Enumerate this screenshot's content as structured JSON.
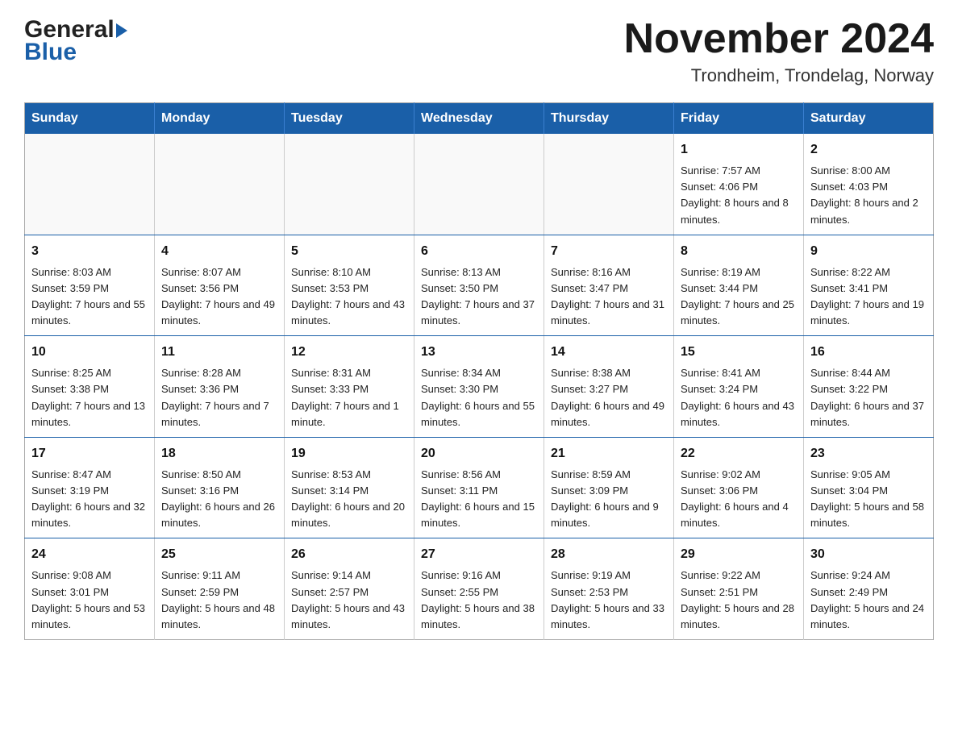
{
  "header": {
    "logo_general": "General",
    "logo_blue": "Blue",
    "month_title": "November 2024",
    "location": "Trondheim, Trondelag, Norway"
  },
  "calendar": {
    "days_of_week": [
      "Sunday",
      "Monday",
      "Tuesday",
      "Wednesday",
      "Thursday",
      "Friday",
      "Saturday"
    ],
    "weeks": [
      [
        {
          "day": "",
          "info": ""
        },
        {
          "day": "",
          "info": ""
        },
        {
          "day": "",
          "info": ""
        },
        {
          "day": "",
          "info": ""
        },
        {
          "day": "",
          "info": ""
        },
        {
          "day": "1",
          "info": "Sunrise: 7:57 AM\nSunset: 4:06 PM\nDaylight: 8 hours and 8 minutes."
        },
        {
          "day": "2",
          "info": "Sunrise: 8:00 AM\nSunset: 4:03 PM\nDaylight: 8 hours and 2 minutes."
        }
      ],
      [
        {
          "day": "3",
          "info": "Sunrise: 8:03 AM\nSunset: 3:59 PM\nDaylight: 7 hours and 55 minutes."
        },
        {
          "day": "4",
          "info": "Sunrise: 8:07 AM\nSunset: 3:56 PM\nDaylight: 7 hours and 49 minutes."
        },
        {
          "day": "5",
          "info": "Sunrise: 8:10 AM\nSunset: 3:53 PM\nDaylight: 7 hours and 43 minutes."
        },
        {
          "day": "6",
          "info": "Sunrise: 8:13 AM\nSunset: 3:50 PM\nDaylight: 7 hours and 37 minutes."
        },
        {
          "day": "7",
          "info": "Sunrise: 8:16 AM\nSunset: 3:47 PM\nDaylight: 7 hours and 31 minutes."
        },
        {
          "day": "8",
          "info": "Sunrise: 8:19 AM\nSunset: 3:44 PM\nDaylight: 7 hours and 25 minutes."
        },
        {
          "day": "9",
          "info": "Sunrise: 8:22 AM\nSunset: 3:41 PM\nDaylight: 7 hours and 19 minutes."
        }
      ],
      [
        {
          "day": "10",
          "info": "Sunrise: 8:25 AM\nSunset: 3:38 PM\nDaylight: 7 hours and 13 minutes."
        },
        {
          "day": "11",
          "info": "Sunrise: 8:28 AM\nSunset: 3:36 PM\nDaylight: 7 hours and 7 minutes."
        },
        {
          "day": "12",
          "info": "Sunrise: 8:31 AM\nSunset: 3:33 PM\nDaylight: 7 hours and 1 minute."
        },
        {
          "day": "13",
          "info": "Sunrise: 8:34 AM\nSunset: 3:30 PM\nDaylight: 6 hours and 55 minutes."
        },
        {
          "day": "14",
          "info": "Sunrise: 8:38 AM\nSunset: 3:27 PM\nDaylight: 6 hours and 49 minutes."
        },
        {
          "day": "15",
          "info": "Sunrise: 8:41 AM\nSunset: 3:24 PM\nDaylight: 6 hours and 43 minutes."
        },
        {
          "day": "16",
          "info": "Sunrise: 8:44 AM\nSunset: 3:22 PM\nDaylight: 6 hours and 37 minutes."
        }
      ],
      [
        {
          "day": "17",
          "info": "Sunrise: 8:47 AM\nSunset: 3:19 PM\nDaylight: 6 hours and 32 minutes."
        },
        {
          "day": "18",
          "info": "Sunrise: 8:50 AM\nSunset: 3:16 PM\nDaylight: 6 hours and 26 minutes."
        },
        {
          "day": "19",
          "info": "Sunrise: 8:53 AM\nSunset: 3:14 PM\nDaylight: 6 hours and 20 minutes."
        },
        {
          "day": "20",
          "info": "Sunrise: 8:56 AM\nSunset: 3:11 PM\nDaylight: 6 hours and 15 minutes."
        },
        {
          "day": "21",
          "info": "Sunrise: 8:59 AM\nSunset: 3:09 PM\nDaylight: 6 hours and 9 minutes."
        },
        {
          "day": "22",
          "info": "Sunrise: 9:02 AM\nSunset: 3:06 PM\nDaylight: 6 hours and 4 minutes."
        },
        {
          "day": "23",
          "info": "Sunrise: 9:05 AM\nSunset: 3:04 PM\nDaylight: 5 hours and 58 minutes."
        }
      ],
      [
        {
          "day": "24",
          "info": "Sunrise: 9:08 AM\nSunset: 3:01 PM\nDaylight: 5 hours and 53 minutes."
        },
        {
          "day": "25",
          "info": "Sunrise: 9:11 AM\nSunset: 2:59 PM\nDaylight: 5 hours and 48 minutes."
        },
        {
          "day": "26",
          "info": "Sunrise: 9:14 AM\nSunset: 2:57 PM\nDaylight: 5 hours and 43 minutes."
        },
        {
          "day": "27",
          "info": "Sunrise: 9:16 AM\nSunset: 2:55 PM\nDaylight: 5 hours and 38 minutes."
        },
        {
          "day": "28",
          "info": "Sunrise: 9:19 AM\nSunset: 2:53 PM\nDaylight: 5 hours and 33 minutes."
        },
        {
          "day": "29",
          "info": "Sunrise: 9:22 AM\nSunset: 2:51 PM\nDaylight: 5 hours and 28 minutes."
        },
        {
          "day": "30",
          "info": "Sunrise: 9:24 AM\nSunset: 2:49 PM\nDaylight: 5 hours and 24 minutes."
        }
      ]
    ]
  }
}
